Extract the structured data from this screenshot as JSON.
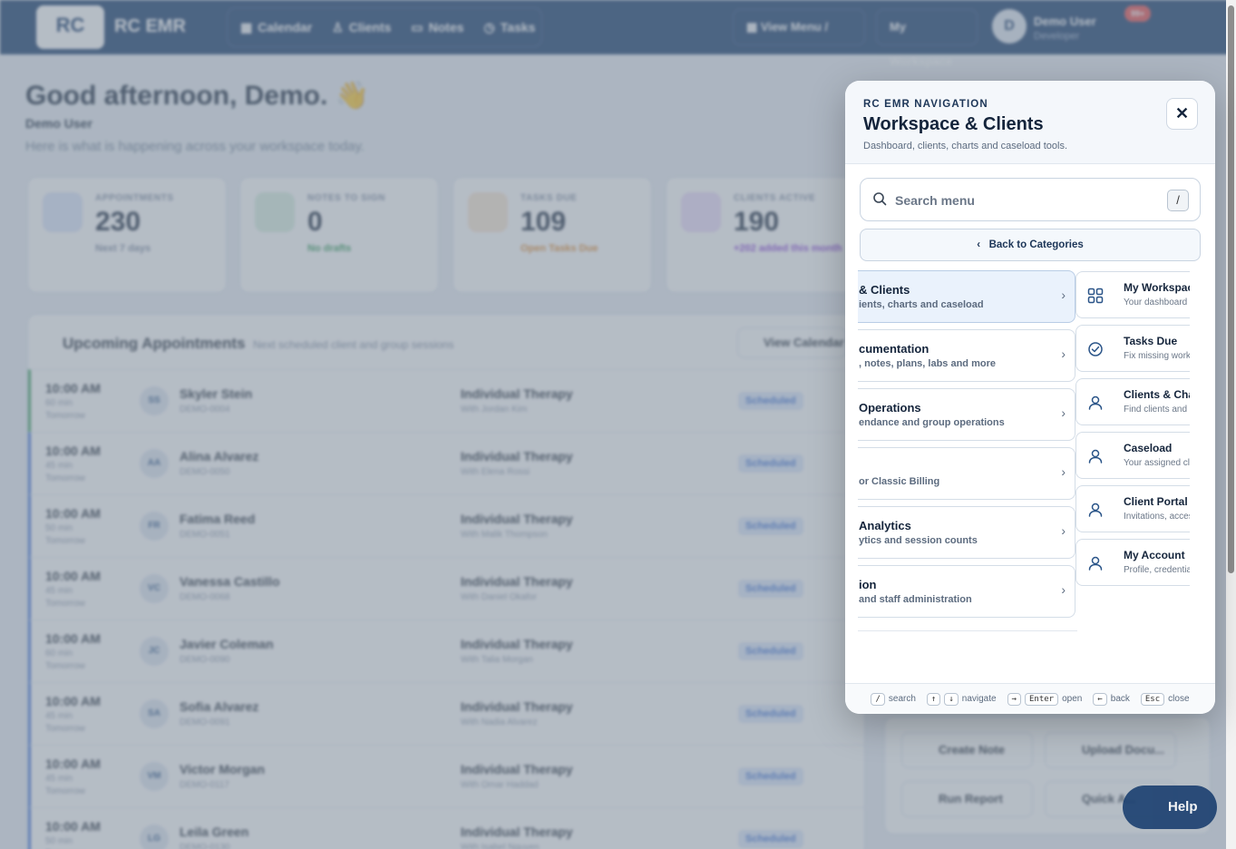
{
  "topbar": {
    "logo_text": "RC",
    "brand": "RC EMR",
    "nav": [
      "Calendar",
      "Clients",
      "Notes",
      "Tasks"
    ],
    "view_menu": "View Menu",
    "view_menu_kbd": "/",
    "my_workspace": "My Workspace",
    "avatar_initial": "D",
    "user_name": "Demo User",
    "user_role": "Developer",
    "badge": "99+"
  },
  "dashboard": {
    "greeting": "Good afternoon, Demo. 👋",
    "user_name": "Demo User",
    "subtitle": "Here is what is happening across your workspace today.",
    "stats": [
      {
        "label": "APPOINTMENTS",
        "value": "230",
        "sub": "Next 7 days",
        "color": "#3a6fd8"
      },
      {
        "label": "NOTES TO SIGN",
        "value": "0",
        "sub": "No drafts",
        "color": "#2e9a55"
      },
      {
        "label": "TASKS DUE",
        "value": "109",
        "sub": "Open Tasks Due",
        "color": "#e08a2c"
      },
      {
        "label": "CLIENTS ACTIVE",
        "value": "190",
        "sub": "+202 added this month",
        "color": "#8a3fd8"
      }
    ],
    "appointments": {
      "title": "Upcoming Appointments",
      "subtitle": "Next scheduled client and group sessions",
      "view_calendar": "View Calendar",
      "rows": [
        {
          "time": "10:00 AM",
          "dur": "60 min",
          "day": "Tomorrow",
          "initials": "SS",
          "name": "Skyler Stein",
          "id": "DEMO-0004",
          "service": "Individual Therapy",
          "with": "With Jordan Kim",
          "status": "Scheduled"
        },
        {
          "time": "10:00 AM",
          "dur": "45 min",
          "day": "Tomorrow",
          "initials": "AA",
          "name": "Alina Alvarez",
          "id": "DEMO-0050",
          "service": "Individual Therapy",
          "with": "With Elena Rossi",
          "status": "Scheduled"
        },
        {
          "time": "10:00 AM",
          "dur": "50 min",
          "day": "Tomorrow",
          "initials": "FR",
          "name": "Fatima Reed",
          "id": "DEMO-0051",
          "service": "Individual Therapy",
          "with": "With Malik Thompson",
          "status": "Scheduled"
        },
        {
          "time": "10:00 AM",
          "dur": "45 min",
          "day": "Tomorrow",
          "initials": "VC",
          "name": "Vanessa Castillo",
          "id": "DEMO-0068",
          "service": "Individual Therapy",
          "with": "With Daniel Okafor",
          "status": "Scheduled"
        },
        {
          "time": "10:00 AM",
          "dur": "60 min",
          "day": "Tomorrow",
          "initials": "JC",
          "name": "Javier Coleman",
          "id": "DEMO-0090",
          "service": "Individual Therapy",
          "with": "With Talia Morgan",
          "status": "Scheduled"
        },
        {
          "time": "10:00 AM",
          "dur": "45 min",
          "day": "Tomorrow",
          "initials": "SA",
          "name": "Sofia Alvarez",
          "id": "DEMO-0091",
          "service": "Individual Therapy",
          "with": "With Nadia Alvarez",
          "status": "Scheduled"
        },
        {
          "time": "10:00 AM",
          "dur": "45 min",
          "day": "Tomorrow",
          "initials": "VM",
          "name": "Victor Morgan",
          "id": "DEMO-0117",
          "service": "Individual Therapy",
          "with": "With Omar Haddad",
          "status": "Scheduled"
        },
        {
          "time": "10:00 AM",
          "dur": "50 min",
          "day": "Tomorrow",
          "initials": "LG",
          "name": "Leila Green",
          "id": "DEMO-0130",
          "service": "Individual Therapy",
          "with": "With Isabel Nguyen",
          "status": "Scheduled"
        }
      ]
    },
    "quick_actions": [
      "Create Note",
      "Upload Docu...",
      "Run Report",
      "Quick A..."
    ],
    "help": "Help"
  },
  "panel": {
    "eyebrow": "RC EMR NAVIGATION",
    "title": "Workspace & Clients",
    "description": "Dashboard, clients, charts and caseload tools.",
    "close": "✕",
    "search_placeholder": "Search menu",
    "search_kbd": "/",
    "back": "Back to Categories",
    "categories": [
      {
        "title": "& Clients",
        "desc": "ients, charts and caseload",
        "active": true
      },
      {
        "title": "cumentation",
        "desc": ", notes, plans, labs and more"
      },
      {
        "title": "Operations",
        "desc": "endance and group operations"
      },
      {
        "title": "",
        "desc": "or Classic Billing"
      },
      {
        "title": "Analytics",
        "desc": "ytics and session counts"
      },
      {
        "title": "ion",
        "desc": "and staff administration"
      }
    ],
    "items": [
      {
        "title": "My Workspace",
        "desc": "Your dashboard a",
        "icon": "grid-icon"
      },
      {
        "title": "Tasks Due",
        "desc": "Fix missing work",
        "icon": "check-circle-icon"
      },
      {
        "title": "Clients & Cha",
        "desc": "Find clients and c",
        "icon": "user-icon"
      },
      {
        "title": "Caseload",
        "desc": "Your assigned cli",
        "icon": "user-icon"
      },
      {
        "title": "Client Portal",
        "desc": "Invitations, acces",
        "icon": "user-icon"
      },
      {
        "title": "My Account",
        "desc": "Profile, credentia",
        "icon": "user-icon"
      }
    ],
    "footer": [
      {
        "keys": [
          "/"
        ],
        "label": "search"
      },
      {
        "keys": [
          "↑",
          "↓"
        ],
        "label": "navigate"
      },
      {
        "keys": [
          "→",
          "Enter"
        ],
        "label": "open"
      },
      {
        "keys": [
          "←"
        ],
        "label": "back"
      },
      {
        "keys": [
          "Esc"
        ],
        "label": "close"
      }
    ]
  }
}
